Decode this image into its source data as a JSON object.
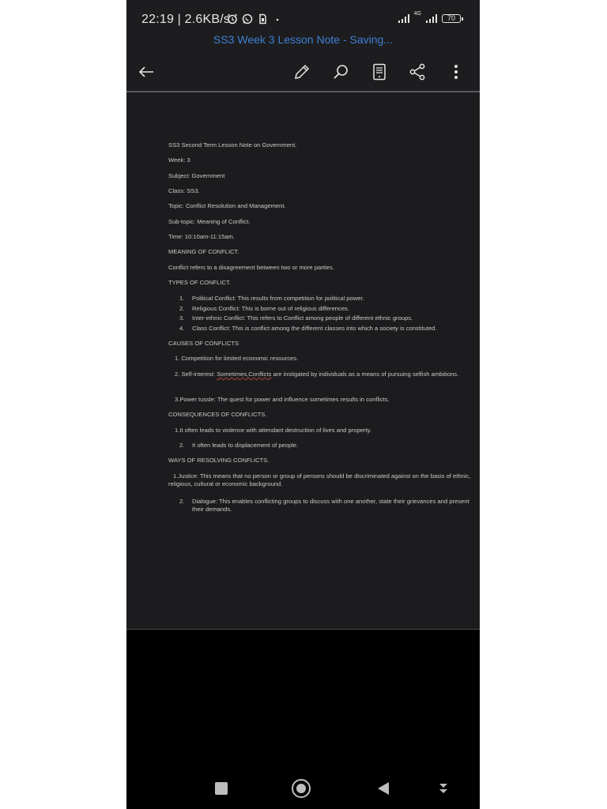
{
  "status_bar": {
    "time": "22:19 | 2.6KB/s",
    "network_label": "4G",
    "battery": "70"
  },
  "header": {
    "document_title": "SS3 Week 3 Lesson Note - Saving..."
  },
  "toolbar": {
    "icons": [
      "back-arrow-icon",
      "pencil-icon",
      "search-icon",
      "reading-mode-icon",
      "share-icon",
      "more-vert-icon"
    ]
  },
  "document": {
    "lines": {
      "l1": "SS3 Second Term Lesson Note on Government.",
      "l2": "Week: 3",
      "l3": "Subject: Government",
      "l4": "Class: SS3.",
      "l5": "Topic: Conflict Resolution and Management.",
      "l6": "Sub-topic: Meaning of Conflict.",
      "l7": "Time: 10:10am-11:15am.",
      "l8": "MEANING OF CONFLICT.",
      "l9": "Conflict refers to a disagreement between two or more parties.",
      "l10": "TYPES OF CONFLICT."
    },
    "types": [
      {
        "n": "1.",
        "text": "Political Conflict: This results from competition for political power."
      },
      {
        "n": "2.",
        "text": "Religious Conflict: This is borne out of religious differences."
      },
      {
        "n": "3.",
        "text": "Inter-ethnic Conflict: This refers to Conflict among people of different ethnic groups."
      },
      {
        "n": "4.",
        "text": "Class Conflict: This is conflict among the different classes into which a society is constituted."
      }
    ],
    "causes_heading": "CAUSES OF CONFLICTS",
    "cause1": "1. Competition for limited economic resources.",
    "cause2_prefix": "2. Self-interest: ",
    "cause2_squiggle": "Sometimes,Conflicts",
    "cause2_rest": " are instigated by individuals as a means of pursuing selfish ambitions.",
    "cause3": "3.Power tussle: The quest for power and influence sometimes results in conflicts.",
    "consequences_heading": "CONSEQUENCES OF CONFLICTS.",
    "consequence1": "1.It often leads to violence with attendant destruction of lives and property.",
    "consequence2_n": "2.",
    "consequence2": "It often leads to displacement of people.",
    "ways_heading": "WAYS OF RESOLVING CONFLICTS.",
    "way1": "1.Justice: This means that no person or group of persons should be discriminated against on the basis of ethnic, religious, cultural or economic background.",
    "way2_n": "2.",
    "way2": "Dialogue: This enables conflicting groups to discuss with one another, state their grievances and present their demands."
  },
  "nav_bar": {
    "icons": [
      "recents-square-icon",
      "home-circle-icon",
      "back-triangle-icon",
      "keyboard-hide-icon"
    ]
  },
  "colors": {
    "title_blue": "#3f7fd6",
    "background": "#1d1d1f",
    "text": "#c9c9c9"
  }
}
